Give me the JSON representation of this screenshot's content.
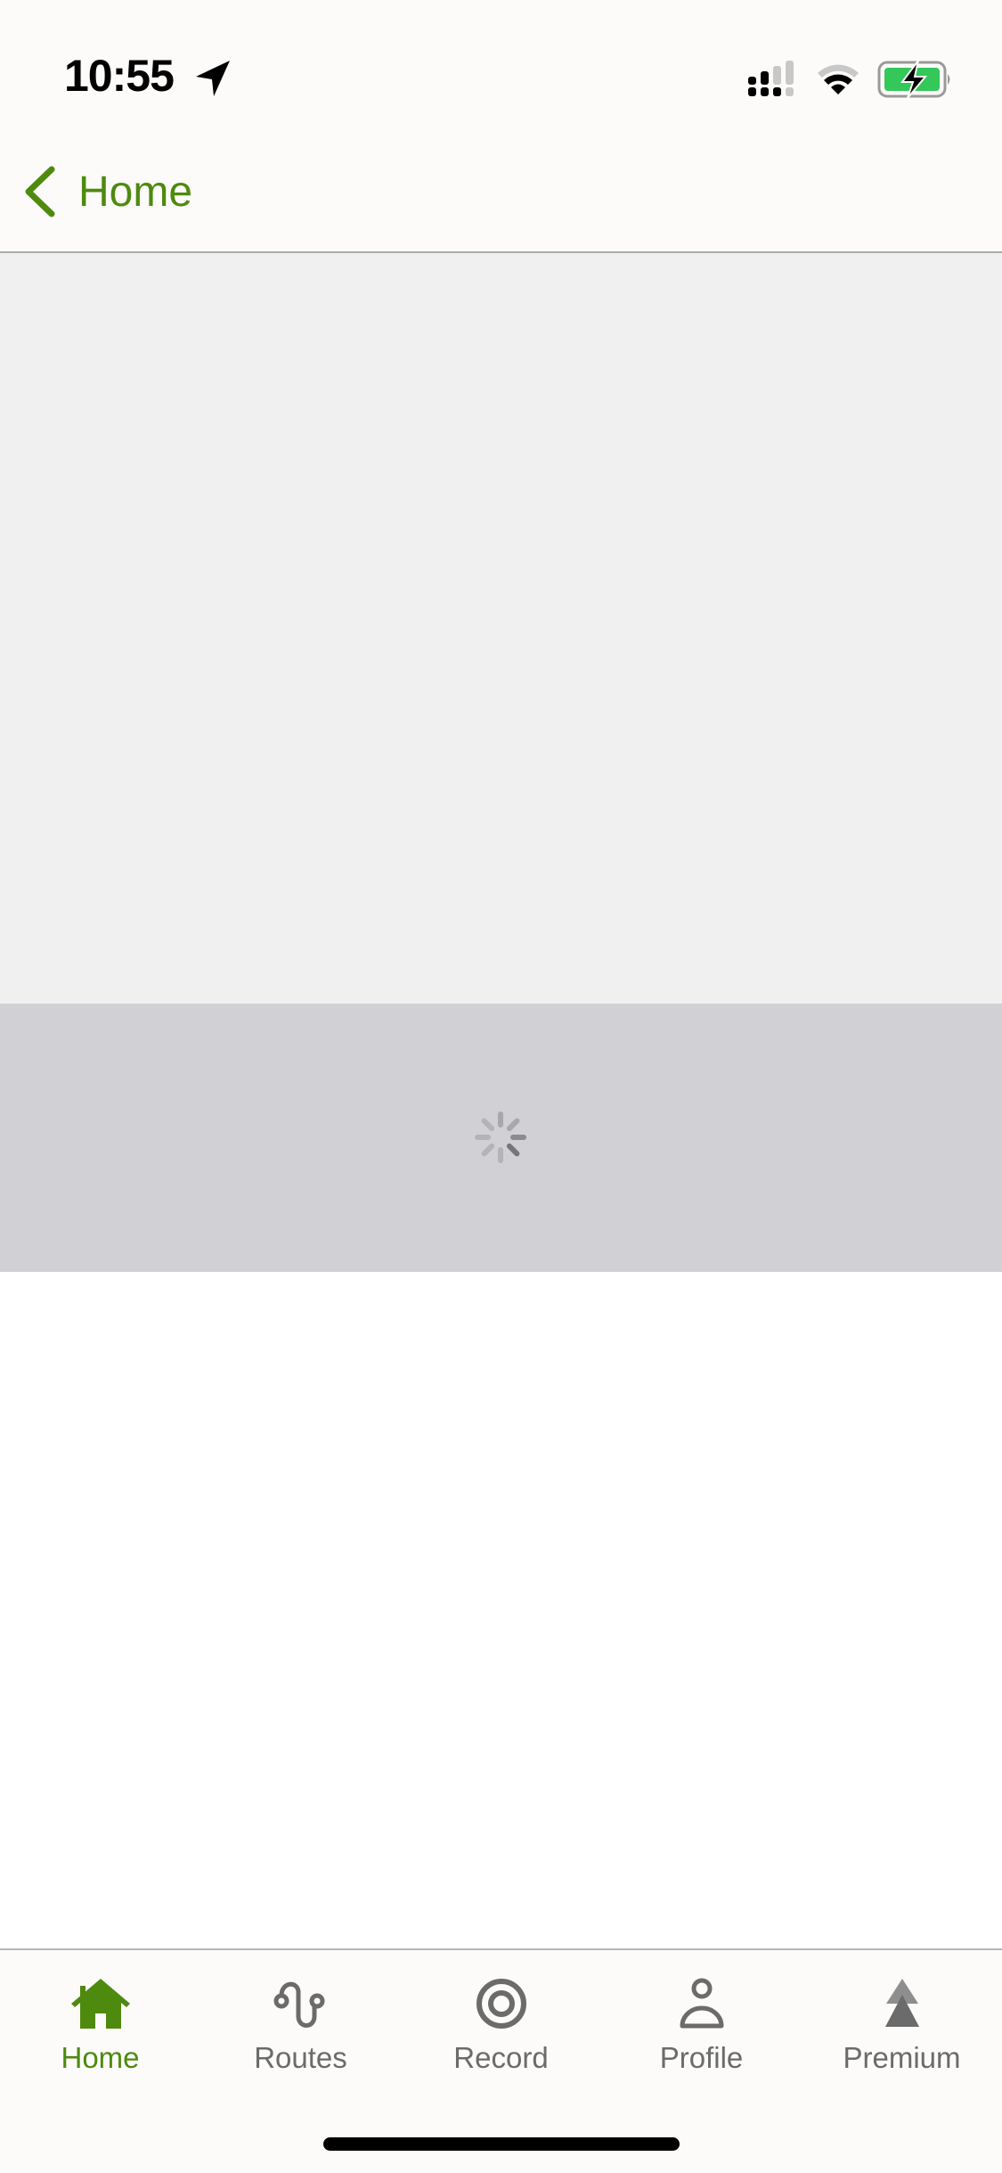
{
  "status_bar": {
    "time": "10:55",
    "icons": [
      "location-arrow-icon",
      "cellular-signal-icon",
      "wifi-icon",
      "battery-charging-icon"
    ]
  },
  "nav_bar": {
    "back_label": "Home",
    "back_icon": "chevron-left-icon"
  },
  "content": {
    "loading_indicator": "spinner"
  },
  "tab_bar": {
    "tabs": [
      {
        "label": "Home",
        "icon": "house-icon",
        "active": true
      },
      {
        "label": "Routes",
        "icon": "route-icon",
        "active": false
      },
      {
        "label": "Record",
        "icon": "record-icon",
        "active": false
      },
      {
        "label": "Profile",
        "icon": "person-icon",
        "active": false
      },
      {
        "label": "Premium",
        "icon": "premium-peaks-icon",
        "active": false
      }
    ]
  },
  "colors": {
    "accent": "#4e8a0e",
    "inactive": "#6b6b6b",
    "battery_fill": "#34c759",
    "map_placeholder": "#f0f0f0",
    "loading_band": "#d1d1d5"
  }
}
